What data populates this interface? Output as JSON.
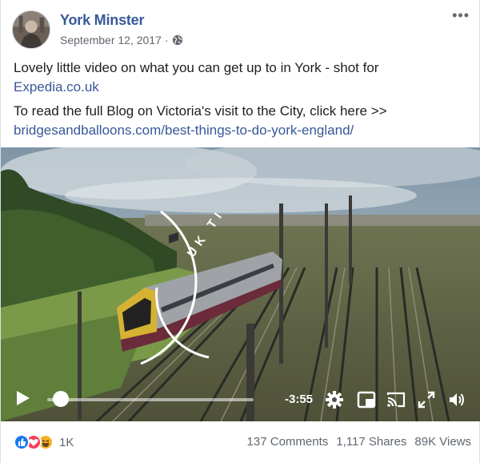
{
  "post": {
    "author": "York Minster",
    "date": "September 12, 2017",
    "separator": "·",
    "privacy_icon": "globe-icon",
    "more_icon": "more-options-icon",
    "more_label": "•••",
    "paragraph1_text": "Lovely little video on what you can get up to in York - shot for",
    "paragraph1_link": "Expedia.co.uk",
    "paragraph2_text": "To read the full Blog on Victoria's visit to the City, click here >>",
    "paragraph2_link": "bridgesandballoons.com/best-things-to-do-york-england/"
  },
  "video": {
    "overlay_text": "UK TI",
    "time_remaining": "-3:55",
    "progress": 0.04,
    "icons": [
      "play-icon",
      "settings-gear-icon",
      "picture-in-picture-icon",
      "cast-icon",
      "fullscreen-icon",
      "volume-icon"
    ]
  },
  "footer": {
    "reactions": [
      "like",
      "love",
      "haha"
    ],
    "reaction_count": "1K",
    "comments": "137 Comments",
    "shares": "1,117 Shares",
    "views": "89K Views"
  },
  "colors": {
    "link": "#385898",
    "secondary_text": "#606770",
    "like_blue": "#1877f2",
    "love_red": "#f33e58",
    "haha_yellow": "#f7b125"
  }
}
